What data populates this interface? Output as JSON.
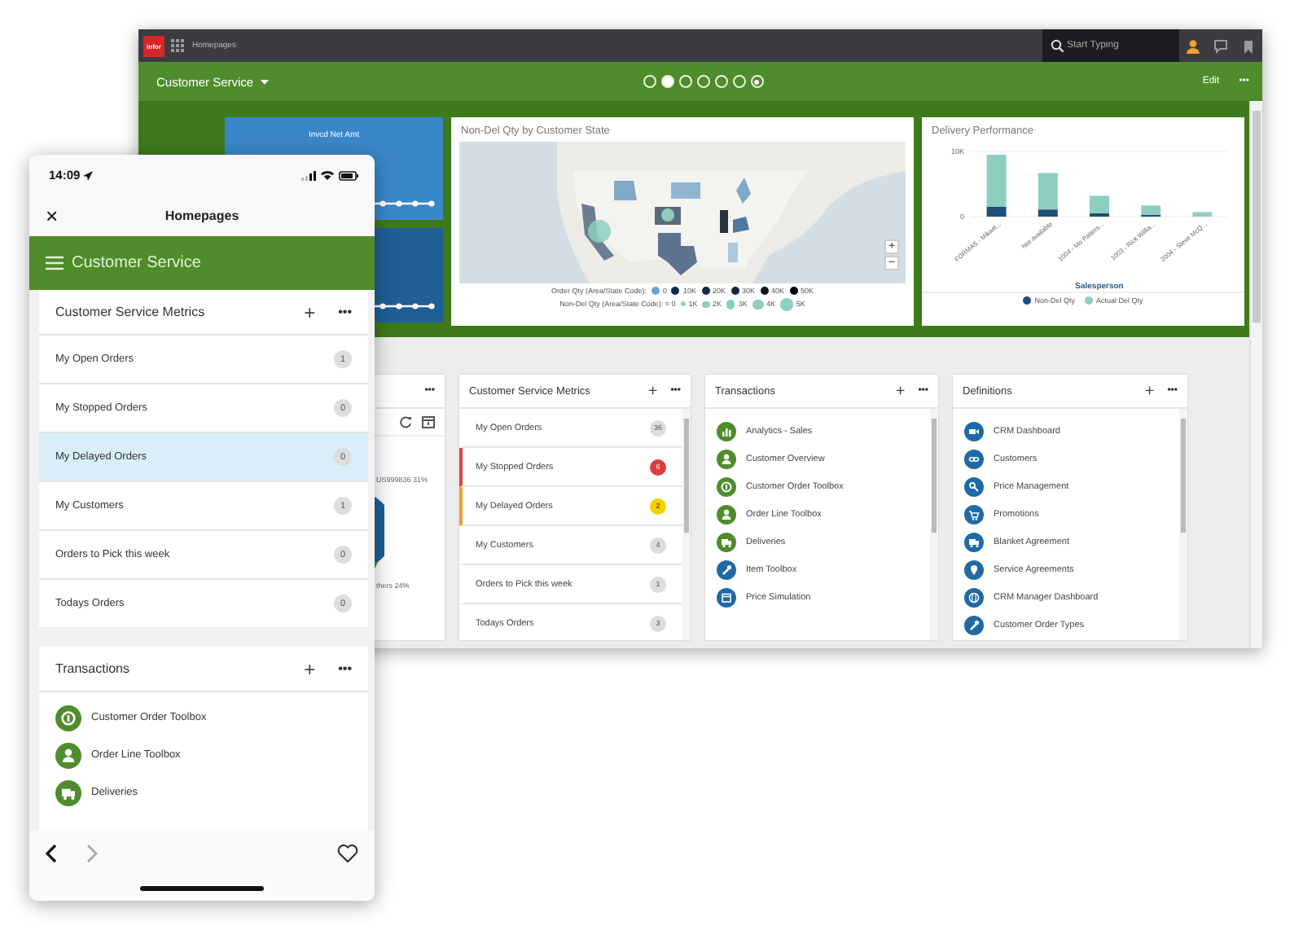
{
  "desktop": {
    "top_bar": {
      "logo": "infor",
      "title": "Homepages",
      "search": {
        "placeholder": "Start Typing"
      }
    },
    "header": {
      "title": "Customer Service",
      "edit": "Edit",
      "more": "•••",
      "pages": [
        {
          "kind": "page",
          "selected": false
        },
        {
          "kind": "page",
          "selected": true
        },
        {
          "kind": "page",
          "selected": false
        },
        {
          "kind": "page",
          "selected": false
        },
        {
          "kind": "page",
          "selected": false
        },
        {
          "kind": "page",
          "selected": false
        },
        {
          "kind": "add",
          "selected": false
        }
      ]
    },
    "kpi_tile": {
      "label": "Invcd Net Amt"
    },
    "map_card": {
      "title": "Non-Del Qty by Customer State",
      "zoom_in": "+",
      "zoom_out": "−",
      "legends": [
        {
          "kind": "color",
          "label": "Order Qty (Area/State Code):",
          "items": [
            {
              "text": "0",
              "color": "#6aa5d8"
            },
            {
              "text": "10K",
              "color": "#10294a"
            },
            {
              "text": "20K",
              "color": "#14284a"
            },
            {
              "text": "30K",
              "color": "#172640"
            },
            {
              "text": "40K",
              "color": "#0d1520"
            },
            {
              "text": "50K",
              "color": "#050505"
            }
          ]
        },
        {
          "kind": "size",
          "label": "Non-Del Qty (Area/State Code): = 0",
          "items": [
            {
              "text": "1K"
            },
            {
              "text": "2K"
            },
            {
              "text": "3K"
            },
            {
              "text": "4K"
            },
            {
              "text": "5K"
            }
          ]
        }
      ]
    },
    "delivery_card": {
      "chart_data": {
        "type": "bar",
        "title": "Delivery Performance",
        "xlabel": "Salesperson",
        "stacked": true,
        "legend": true,
        "categories": [
          "FORMAS - Mikael...",
          "Not available",
          "1004 - Mo Patters...",
          "1003 - Rick Willia...",
          "2004 - Steve McQ..."
        ],
        "ylim": [
          0,
          10000
        ],
        "yticks": [
          {
            "value": 0,
            "label": "0"
          },
          {
            "value": 10000,
            "label": "10K"
          }
        ],
        "series": [
          {
            "name": "Non-Del Qty",
            "color": "#1f4e79",
            "values": [
              1500,
              1100,
              500,
              300,
              0
            ]
          },
          {
            "name": "Actual Del Qty",
            "color": "#8ccfc1",
            "values": [
              8000,
              5600,
              2700,
              1400,
              700
            ]
          }
        ]
      }
    },
    "side_card": {
      "more": "•••",
      "labels": [
        "US999836 31%",
        "thers 24%"
      ]
    },
    "metrics_card": {
      "title": "Customer Service Metrics",
      "add": "+",
      "more": "•••",
      "rows": [
        {
          "label": "My Open Orders",
          "count": "36",
          "kind": "normal"
        },
        {
          "label": "My Stopped Orders",
          "count": "6",
          "kind": "alert"
        },
        {
          "label": "My Delayed Orders",
          "count": "2",
          "kind": "warning"
        },
        {
          "label": "My Customers",
          "count": "4",
          "kind": "normal"
        },
        {
          "label": "Orders to Pick this week",
          "count": "1",
          "kind": "normal"
        },
        {
          "label": "Todays Orders",
          "count": "3",
          "kind": "normal"
        }
      ]
    },
    "transactions_card": {
      "title": "Transactions",
      "add": "+",
      "more": "•••",
      "items": [
        {
          "label": "Analytics - Sales",
          "kind": "chart",
          "color": "#4f8c2b"
        },
        {
          "label": "Customer Overview",
          "kind": "person",
          "color": "#4f8c2b"
        },
        {
          "label": "Customer Order Toolbox",
          "kind": "coin",
          "color": "#4f8c2b"
        },
        {
          "label": "Order Line Toolbox",
          "kind": "person",
          "color": "#4f8c2b"
        },
        {
          "label": "Deliveries",
          "kind": "truck",
          "color": "#4f8c2b"
        },
        {
          "label": "Item Toolbox",
          "kind": "wrench",
          "color": "#1f6aa5"
        },
        {
          "label": "Price Simulation",
          "kind": "calendar",
          "color": "#1f6aa5"
        }
      ]
    },
    "definitions_card": {
      "title": "Definitions",
      "add": "+",
      "more": "•••",
      "items": [
        {
          "label": "CRM Dashboard",
          "kind": "camera"
        },
        {
          "label": "Customers",
          "kind": "link"
        },
        {
          "label": "Price Management",
          "kind": "key"
        },
        {
          "label": "Promotions",
          "kind": "cart"
        },
        {
          "label": "Blanket Agreement",
          "kind": "truck"
        },
        {
          "label": "Service Agreements",
          "kind": "pin"
        },
        {
          "label": "CRM Manager Dashboard",
          "kind": "globe"
        },
        {
          "label": "Customer Order Types",
          "kind": "wrench"
        }
      ]
    }
  },
  "phone": {
    "time": "14:09",
    "close": "×",
    "title": "Homepages",
    "banner": "Customer Service",
    "metrics_card": {
      "title": "Customer Service Metrics",
      "add": "+",
      "more": "•••",
      "rows": [
        {
          "label": "My Open Orders",
          "count": "1",
          "selected": false
        },
        {
          "label": "My Stopped Orders",
          "count": "0",
          "selected": false
        },
        {
          "label": "My Delayed Orders",
          "count": "0",
          "selected": true
        },
        {
          "label": "My Customers",
          "count": "1",
          "selected": false
        },
        {
          "label": "Orders to Pick this week",
          "count": "0",
          "selected": false
        },
        {
          "label": "Todays Orders",
          "count": "0",
          "selected": false
        }
      ]
    },
    "transactions_card": {
      "title": "Transactions",
      "add": "+",
      "more": "•••",
      "items": [
        {
          "label": "Customer Order Toolbox",
          "kind": "coin"
        },
        {
          "label": "Order Line Toolbox",
          "kind": "person"
        },
        {
          "label": "Deliveries",
          "kind": "truck"
        }
      ]
    }
  }
}
